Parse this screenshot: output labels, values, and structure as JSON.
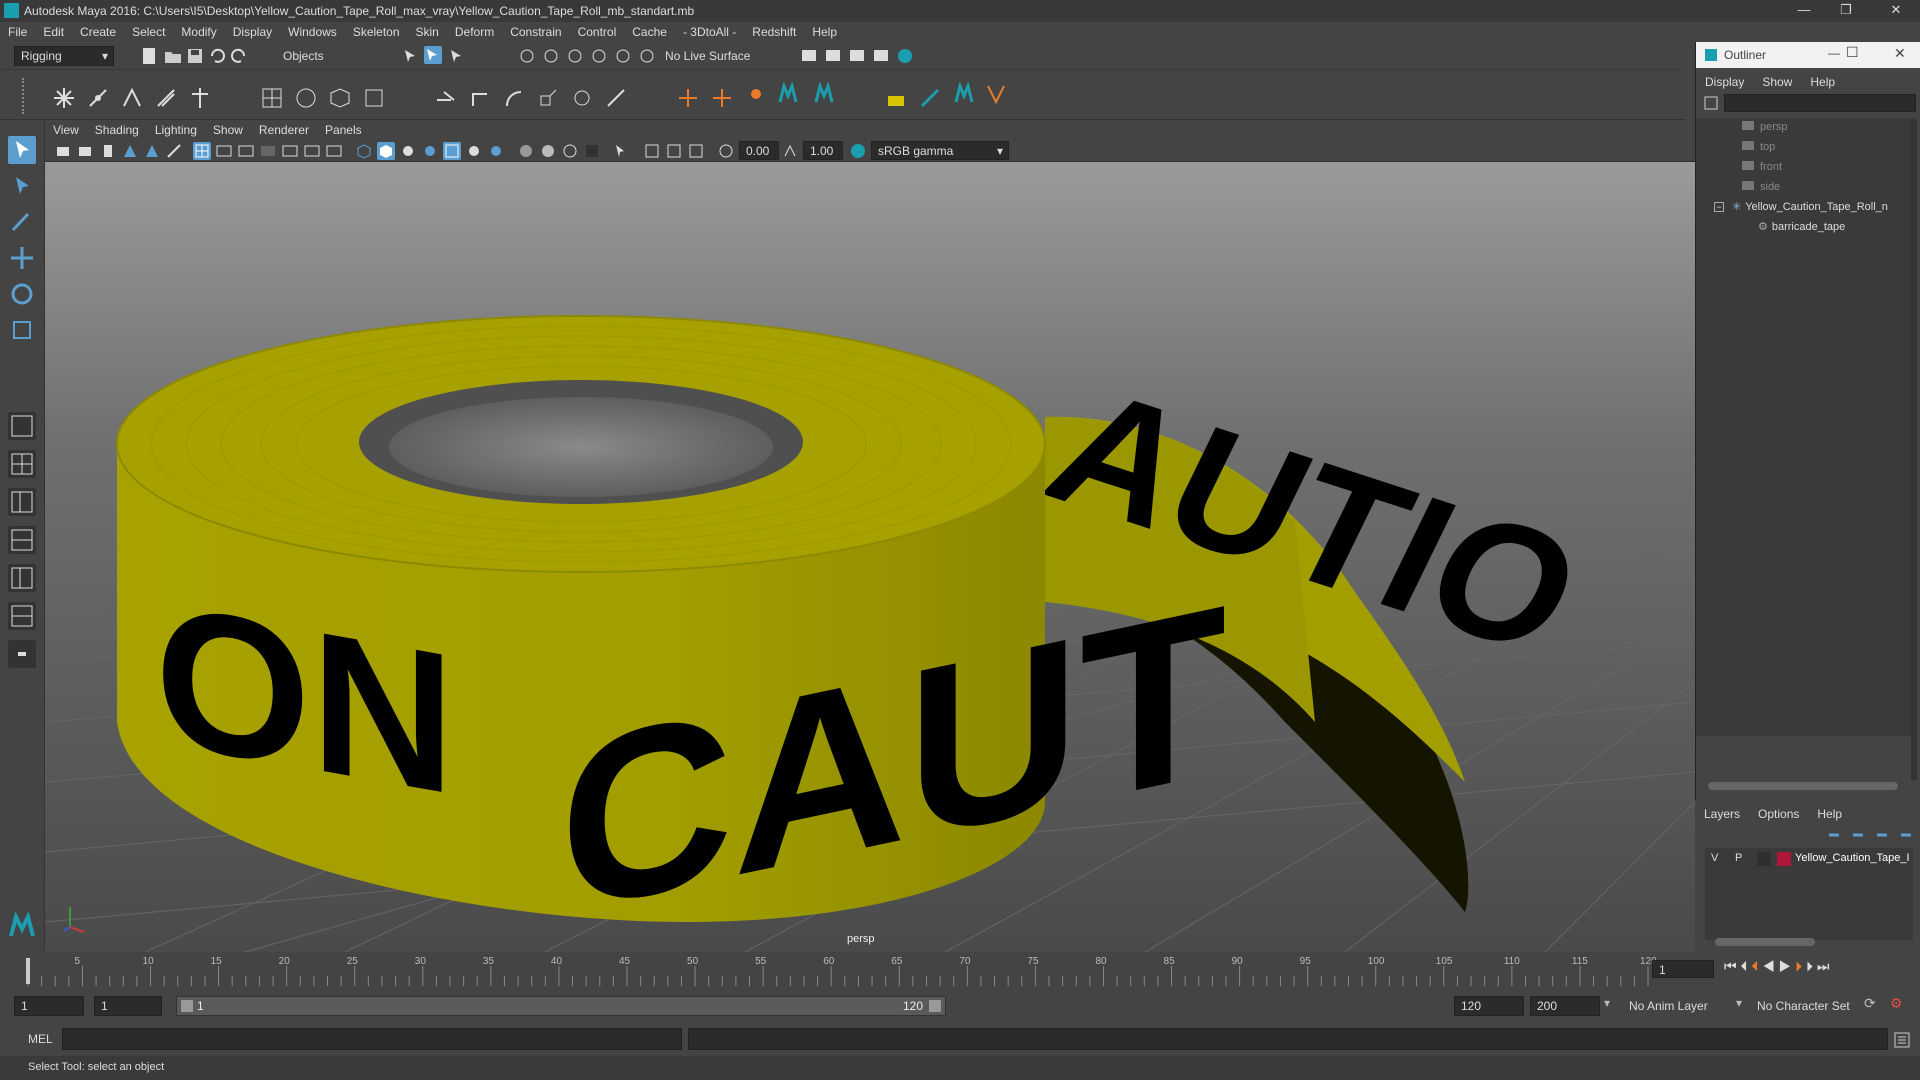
{
  "title_bar": {
    "title": "Autodesk Maya 2016: C:\\Users\\I5\\Desktop\\Yellow_Caution_Tape_Roll_max_vray\\Yellow_Caution_Tape_Roll_mb_standart.mb",
    "minimize": "—",
    "restore": "❐",
    "close": "✕"
  },
  "menu": [
    "File",
    "Edit",
    "Create",
    "Select",
    "Modify",
    "Display",
    "Windows",
    "Skeleton",
    "Skin",
    "Deform",
    "Constrain",
    "Control",
    "Cache",
    "- 3DtoAll -",
    "Redshift",
    "Help"
  ],
  "status_line": {
    "mode": "Rigging",
    "select_mode": "Objects",
    "live_surface": "No Live Surface"
  },
  "viewport": {
    "menu": [
      "View",
      "Shading",
      "Lighting",
      "Show",
      "Renderer",
      "Panels"
    ],
    "exposure": "0.00",
    "gamma": "1.00",
    "color_space": "sRGB gamma",
    "camera_label": "persp",
    "tape_text": "CAUTION"
  },
  "outliner": {
    "title": "Outliner",
    "menu": [
      "Display",
      "Show",
      "Help"
    ],
    "items": [
      {
        "label": "persp",
        "dim": true
      },
      {
        "label": "top",
        "dim": true
      },
      {
        "label": "front",
        "dim": true
      },
      {
        "label": "side",
        "dim": true
      },
      {
        "label": "Yellow_Caution_Tape_Roll_n",
        "dim": false
      },
      {
        "label": "barricade_tape",
        "dim": false
      }
    ]
  },
  "layers": {
    "menu": [
      "Layers",
      "Options",
      "Help"
    ],
    "row": {
      "v": "V",
      "p": "P",
      "name": "Yellow_Caution_Tape_I",
      "color": "#b0163a"
    }
  },
  "timeline": {
    "ticks": [
      "1",
      "5",
      "10",
      "15",
      "20",
      "25",
      "30",
      "35",
      "40",
      "45",
      "50",
      "55",
      "60",
      "65",
      "70",
      "75",
      "80",
      "85",
      "90",
      "95",
      "100",
      "105",
      "110",
      "115",
      "120"
    ],
    "current_frame": "1"
  },
  "range": {
    "start": "1",
    "start_inner": "1",
    "slider_start": "1",
    "slider_end": "120",
    "end_inner": "120",
    "end": "200",
    "anim_layer": "No Anim Layer",
    "char_set": "No Character Set"
  },
  "command": {
    "label": "MEL"
  },
  "help_line": "Select Tool: select an object",
  "colors": {
    "tape_yellow": "#a5a000",
    "tape_yellow_light": "#b8b300",
    "accent_blue": "#5b9ecf",
    "grid_floor": "#5d5d5d"
  }
}
